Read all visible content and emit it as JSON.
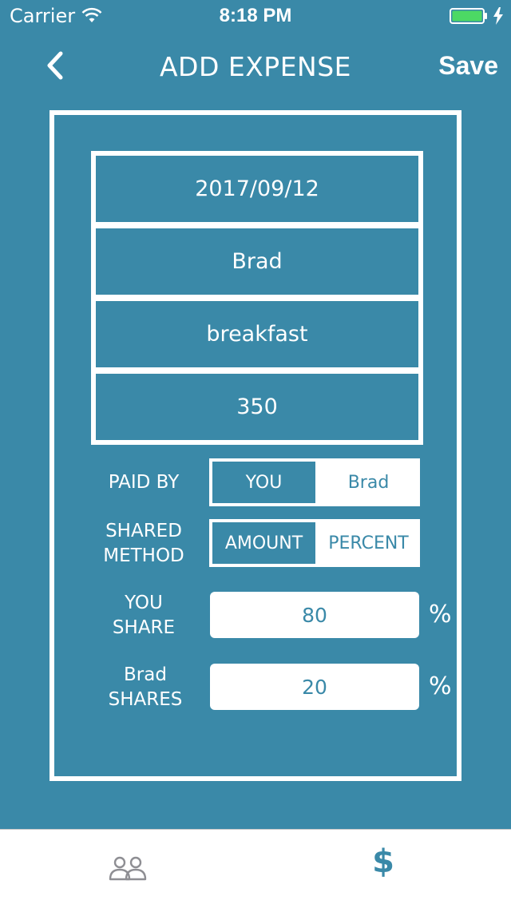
{
  "status_bar": {
    "carrier": "Carrier",
    "time": "8:18 PM"
  },
  "nav": {
    "title": "ADD EXPENSE",
    "save_label": "Save"
  },
  "form": {
    "date": "2017/09/12",
    "friend": "Brad",
    "description": "breakfast",
    "amount": "350"
  },
  "paid_by": {
    "label": "PAID BY",
    "options": [
      "YOU",
      "Brad"
    ],
    "selected": "YOU"
  },
  "shared_method": {
    "label": "SHARED\nMETHOD",
    "options": [
      "AMOUNT",
      "PERCENT"
    ],
    "selected": "AMOUNT"
  },
  "you_share": {
    "label": "YOU\nSHARE",
    "value": "80",
    "unit": "%"
  },
  "friend_share": {
    "label": "Brad\nSHARES",
    "value": "20",
    "unit": "%"
  },
  "tab_bar": {
    "tabs": [
      {
        "icon": "friends-icon",
        "selected": false
      },
      {
        "icon": "dollar-icon",
        "glyph": "$",
        "selected": true
      }
    ]
  },
  "colors": {
    "primary": "#3a89a8",
    "white": "#ffffff",
    "battery": "#4cd964"
  }
}
